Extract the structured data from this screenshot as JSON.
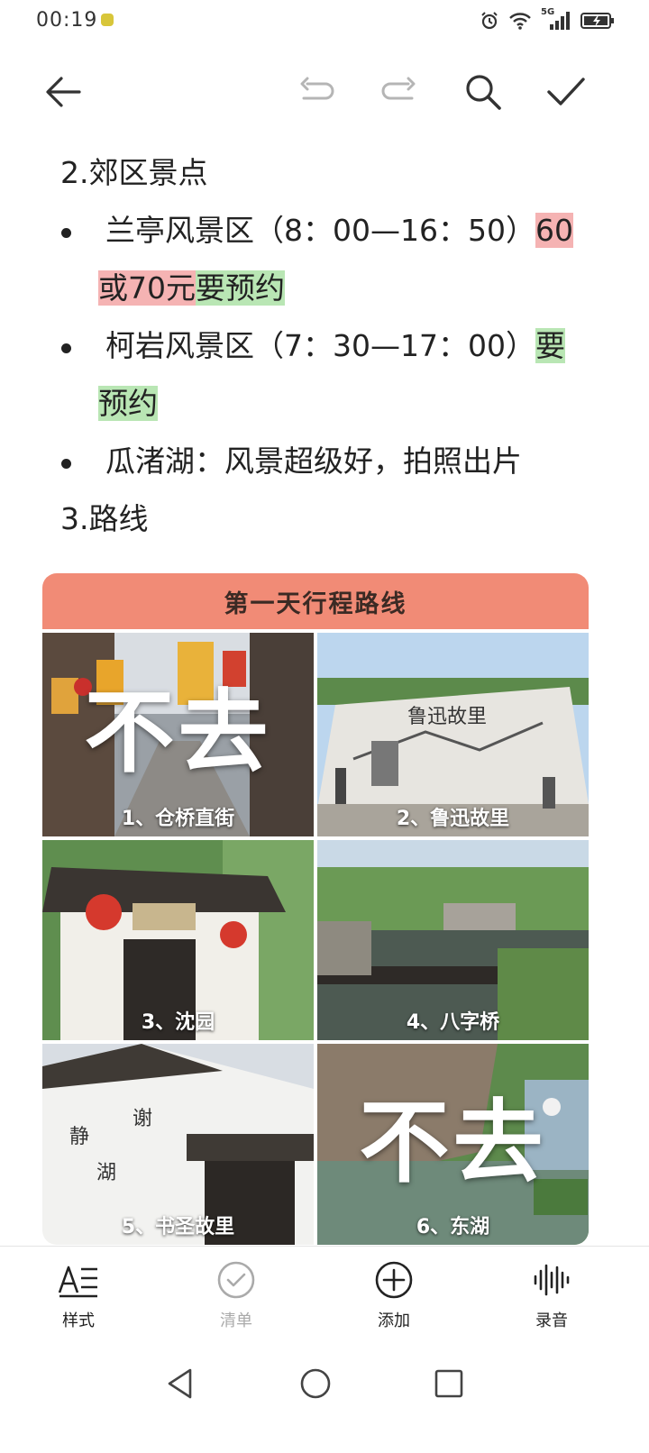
{
  "status_bar": {
    "time": "00:19",
    "network": "5G"
  },
  "toolbar": {
    "back_icon": "arrow-left-icon",
    "undo_icon": "undo-icon",
    "redo_icon": "redo-icon",
    "search_icon": "search-icon",
    "confirm_icon": "checkmark-icon"
  },
  "content": {
    "heading_suburbs": "2.郊区景点",
    "items": [
      {
        "text": "兰亭风景区（8：00—16：50）",
        "hl_red_1": "60",
        "hl_red_2": "或70元",
        "hl_green": "要预约"
      },
      {
        "text": "柯岩风景区（7：30—17：00）",
        "hl_green_1": "要",
        "hl_green_2": "预约"
      },
      {
        "text": "瓜渚湖：风景超级好，拍照出片"
      }
    ],
    "heading_route": "3.路线"
  },
  "image_card": {
    "title": "第一天行程路线",
    "tiles": [
      {
        "label": "1、仓桥直街",
        "overlay": "不去"
      },
      {
        "label": "2、鲁迅故里"
      },
      {
        "label": "3、沈园"
      },
      {
        "label": "4、八字桥"
      },
      {
        "label": "5、书圣故里"
      },
      {
        "label": "6、东湖",
        "overlay": "不去"
      }
    ]
  },
  "bottom_nav": {
    "items": [
      {
        "label": "样式",
        "icon": "text-style-icon"
      },
      {
        "label": "清单",
        "icon": "checklist-icon"
      },
      {
        "label": "添加",
        "icon": "add-circle-icon"
      },
      {
        "label": "录音",
        "icon": "audio-wave-icon"
      }
    ]
  },
  "colors": {
    "highlight_red": "#f5b3b3",
    "highlight_green": "#b9e6b4",
    "card_header": "#f18b76"
  }
}
